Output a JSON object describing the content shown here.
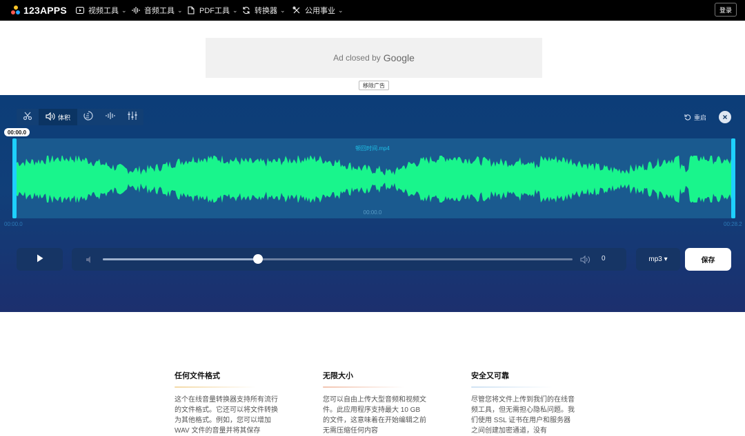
{
  "nav": {
    "logo": "123APPS",
    "items": [
      {
        "label": "视频工具",
        "icon": "video-play-icon"
      },
      {
        "label": "音频工具",
        "icon": "audio-wave-icon"
      },
      {
        "label": "PDF工具",
        "icon": "pdf-file-icon"
      },
      {
        "label": "转换器",
        "icon": "convert-arrows-icon"
      },
      {
        "label": "公用事业",
        "icon": "tools-icon"
      }
    ],
    "login": "登录"
  },
  "ad": {
    "text": "Ad closed by",
    "brand": "Google",
    "remove": "移除广告"
  },
  "editor": {
    "tools": [
      {
        "name": "cut",
        "icon": "scissors-icon"
      },
      {
        "name": "volume",
        "icon": "speaker-icon",
        "label": "体积"
      },
      {
        "name": "speed",
        "icon": "speed-icon"
      },
      {
        "name": "equalize",
        "icon": "waveform-icon"
      },
      {
        "name": "adjust",
        "icon": "sliders-icon"
      }
    ],
    "restart": "重启",
    "start_badge": "00:00.0",
    "filename": "顿回时间.mp4",
    "wave_time": "00:00.0",
    "time_left": "00:00.0",
    "time_right": "00:28.2",
    "volume_value": "0",
    "volume_level": 0.33,
    "format": "mp3 ▾",
    "save": "保存",
    "wave_color": "#19f58c"
  },
  "features": [
    {
      "title": "任何文件格式",
      "color": "#f3d9a6",
      "text": "这个在线音量转换器支持所有流行的文件格式。它还可以将文件转换为其他格式。例如，您可以增加 WAV 文件的音量并将其保存"
    },
    {
      "title": "无限大小",
      "color": "#f2c4b0",
      "text": "您可以自由上传大型音频和视频文件。此应用程序支持最大 10 GB 的文件，这意味着在开始编辑之前无需压缩任何内容"
    },
    {
      "title": "安全又可靠",
      "color": "#cfe2f3",
      "text": "尽管您将文件上传到我们的在线音频工具，但无需担心隐私问题。我们使用 SSL 证书在用户和服务器之间创建加密通道，没有"
    }
  ]
}
